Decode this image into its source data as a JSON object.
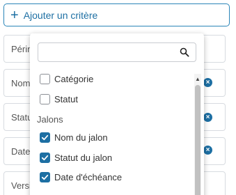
{
  "add_button": {
    "label": "Ajouter un critère"
  },
  "fields": [
    {
      "label": "Périn"
    },
    {
      "label": "Nom"
    },
    {
      "label": "Statu"
    },
    {
      "label": "Date"
    },
    {
      "label": "Versi"
    }
  ],
  "dropdown": {
    "search": {
      "value": "",
      "placeholder": ""
    },
    "items_top": [
      {
        "label": "Catégorie",
        "checked": false
      },
      {
        "label": "Statut",
        "checked": false
      }
    ],
    "group": {
      "label": "Jalons"
    },
    "group_items": [
      {
        "label": "Nom du jalon",
        "checked": true
      },
      {
        "label": "Statut du jalon",
        "checked": true
      },
      {
        "label": "Date d'échéance",
        "checked": true
      }
    ]
  },
  "colors": {
    "accent": "#1d6fa3",
    "border": "#d7dbe0"
  },
  "icons": {
    "add": "plus-icon",
    "search": "magnifier-icon",
    "remove": "close-circle-icon",
    "check": "checkmark-icon"
  }
}
